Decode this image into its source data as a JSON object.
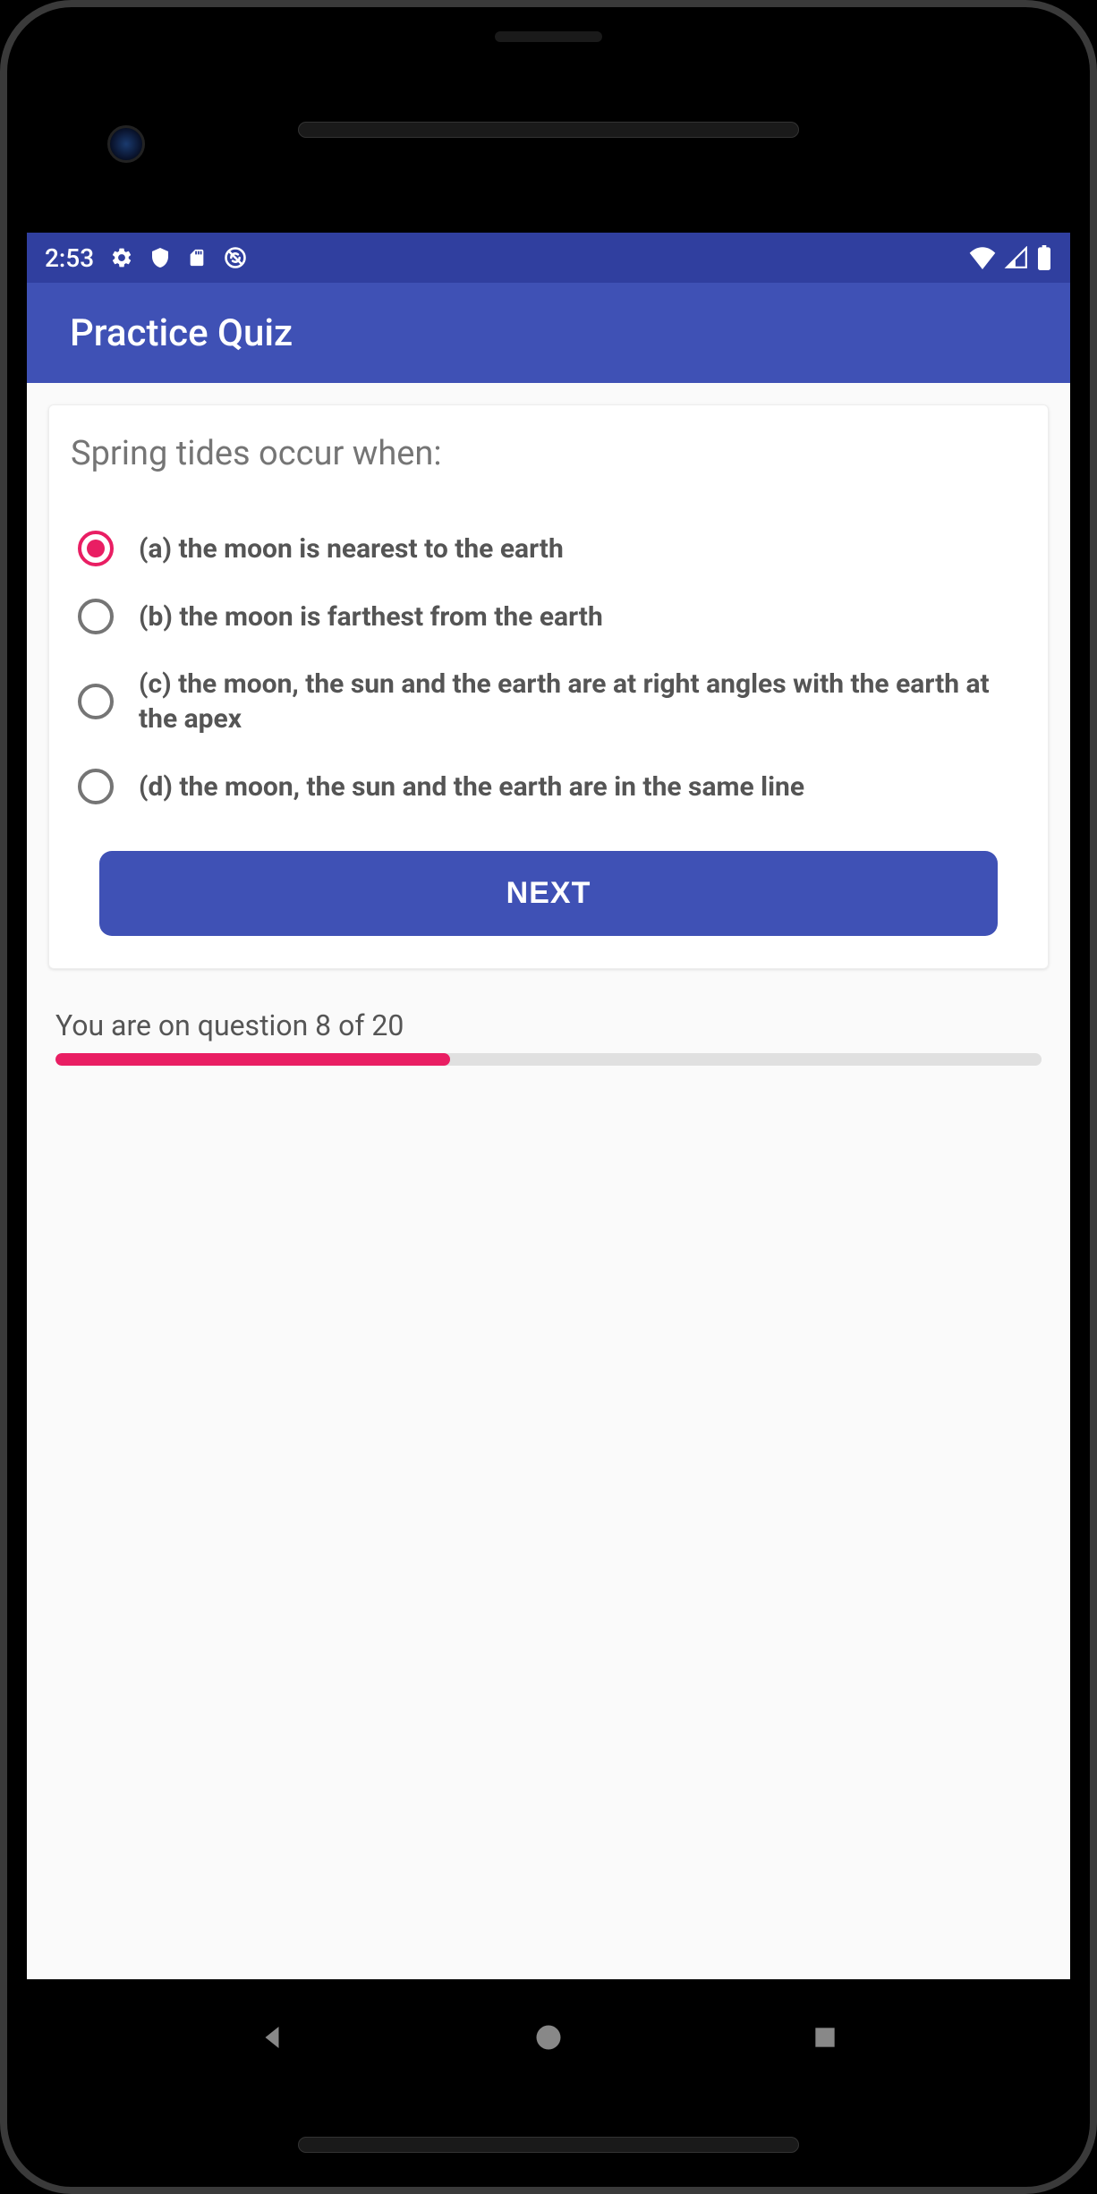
{
  "status_bar": {
    "time": "2:53"
  },
  "app_bar": {
    "title": "Practice Quiz"
  },
  "quiz": {
    "question": "Spring tides occur when:",
    "options": [
      {
        "label": "(a) the moon is nearest to the earth",
        "selected": true
      },
      {
        "label": "(b) the moon is farthest from the earth",
        "selected": false
      },
      {
        "label": "(c) the moon, the sun and the earth are at right angles with the earth at the apex",
        "selected": false
      },
      {
        "label": "(d) the moon, the sun and the earth are in the same line",
        "selected": false
      }
    ],
    "next_button_label": "NEXT"
  },
  "progress": {
    "text": "You are on question 8 of 20",
    "current": 8,
    "total": 20,
    "percent": 40
  }
}
